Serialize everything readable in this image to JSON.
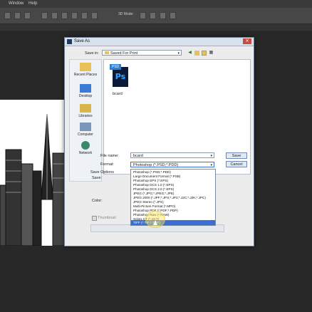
{
  "menu": [
    "Window",
    "Help"
  ],
  "toolbar": {
    "mode_label": "3D Mode:"
  },
  "dialog": {
    "title": "Save As",
    "save_in_label": "Save in:",
    "save_in_value": "Saved For Print",
    "places": [
      "Recent Places",
      "Desktop",
      "Libraries",
      "Computer",
      "Network"
    ],
    "file": {
      "tag": "PSD",
      "glyph": "Ps",
      "name": "bcard"
    },
    "file_name_label": "File name:",
    "file_name_value": "bcard",
    "format_label": "Format:",
    "format_value": "Photoshop (*.PSD;*.PDD)",
    "save_button": "Save",
    "cancel_button": "Cancel",
    "save_options_label": "Save Options",
    "save_label": "Save:",
    "color_label": "Color:",
    "thumbnail_label": "Thumbnail",
    "format_options": [
      "Photoshop (*.PSD;*.PDD)",
      "Large Document Format (*.PSB)",
      "Photoshop EPS (*.EPS)",
      "Photoshop DCS 1.0 (*.EPS)",
      "Photoshop DCS 2.0 (*.EPS)",
      "JPEG (*.JPG;*.JPEG;*.JPE)",
      "JPEG 2000 (*.JPF;*.JPX;*.JP2;*.J2C;*.J2K;*.JPC)",
      "JPEG Stereo (*.JPS)",
      "Multi-Picture Format (*.MPO)",
      "Photoshop PDF (*.PDF;*.PDP)",
      "Photoshop Raw (*.RAW)",
      "Scitex CT (*.SCT)",
      "TIFF (*.TIF;*.TIFF)"
    ],
    "selected_option": "TIFF (*.TIF;*.TIFF)"
  },
  "colors": {
    "accent": "#3a6fd1",
    "app_bg": "#2b2b2b",
    "dialog_bg": "#ececec"
  }
}
